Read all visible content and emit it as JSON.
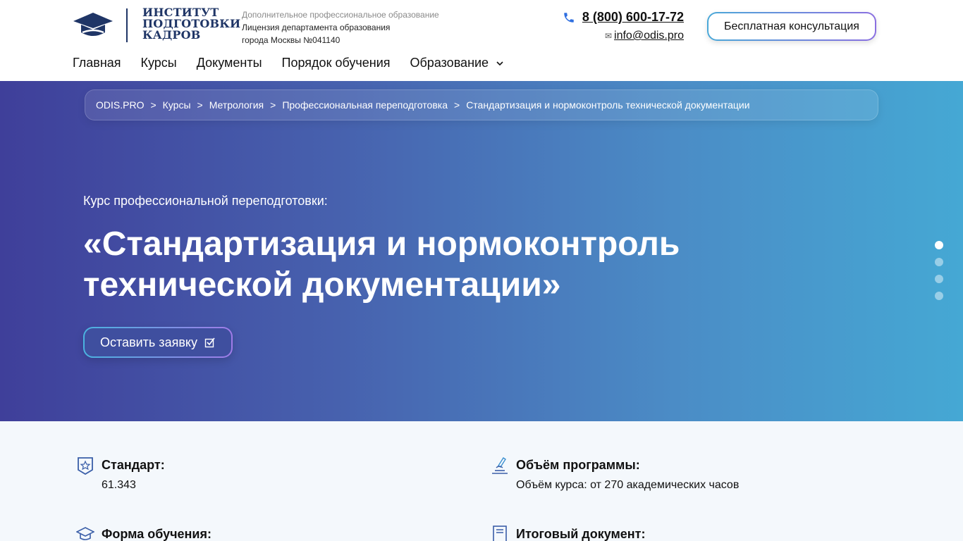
{
  "logo": {
    "line1": "ИНСТИТУТ",
    "line2": "ПОДГОТОВКИ",
    "line3": "КАДРОВ",
    "icon": "graduation-cap-icon"
  },
  "license": {
    "line1": "Дополнительное профессиональное образование",
    "line2": "Лицензия департамента образования",
    "line3": "города Москвы №041140"
  },
  "contacts": {
    "phone": "8 (800) 600-17-72",
    "email": "info@odis.pro",
    "email_icon": "✉"
  },
  "header": {
    "consult_label": "Бесплатная консультация"
  },
  "nav": {
    "items": [
      "Главная",
      "Курсы",
      "Документы",
      "Порядок обучения",
      "Образование"
    ]
  },
  "breadcrumb": [
    "ODIS.PRO",
    "Курсы",
    "Метрология",
    "Профессиональная переподготовка",
    "Стандартизация и нормоконтроль технической документации"
  ],
  "breadcrumb_sep": ">",
  "hero": {
    "subtitle": "Курс профессиональной переподготовки:",
    "title": "«Стандартизация и нормоконтроль технической документации»",
    "apply_label": "Оставить заявку",
    "slides": 4,
    "active_slide": 1
  },
  "info": {
    "standard_label": "Стандарт:",
    "standard_value": "61.343",
    "volume_label": "Объём программы:",
    "volume_value": "Объём курса: от 270 академических часов",
    "form_label": "Форма обучения:",
    "doc_label": "Итоговый документ:"
  },
  "colors": {
    "brand_dark": "#1f3566",
    "hero_start": "#3f3f9a",
    "hero_end": "#45a8d4",
    "info_bg": "#f4f8fc"
  }
}
